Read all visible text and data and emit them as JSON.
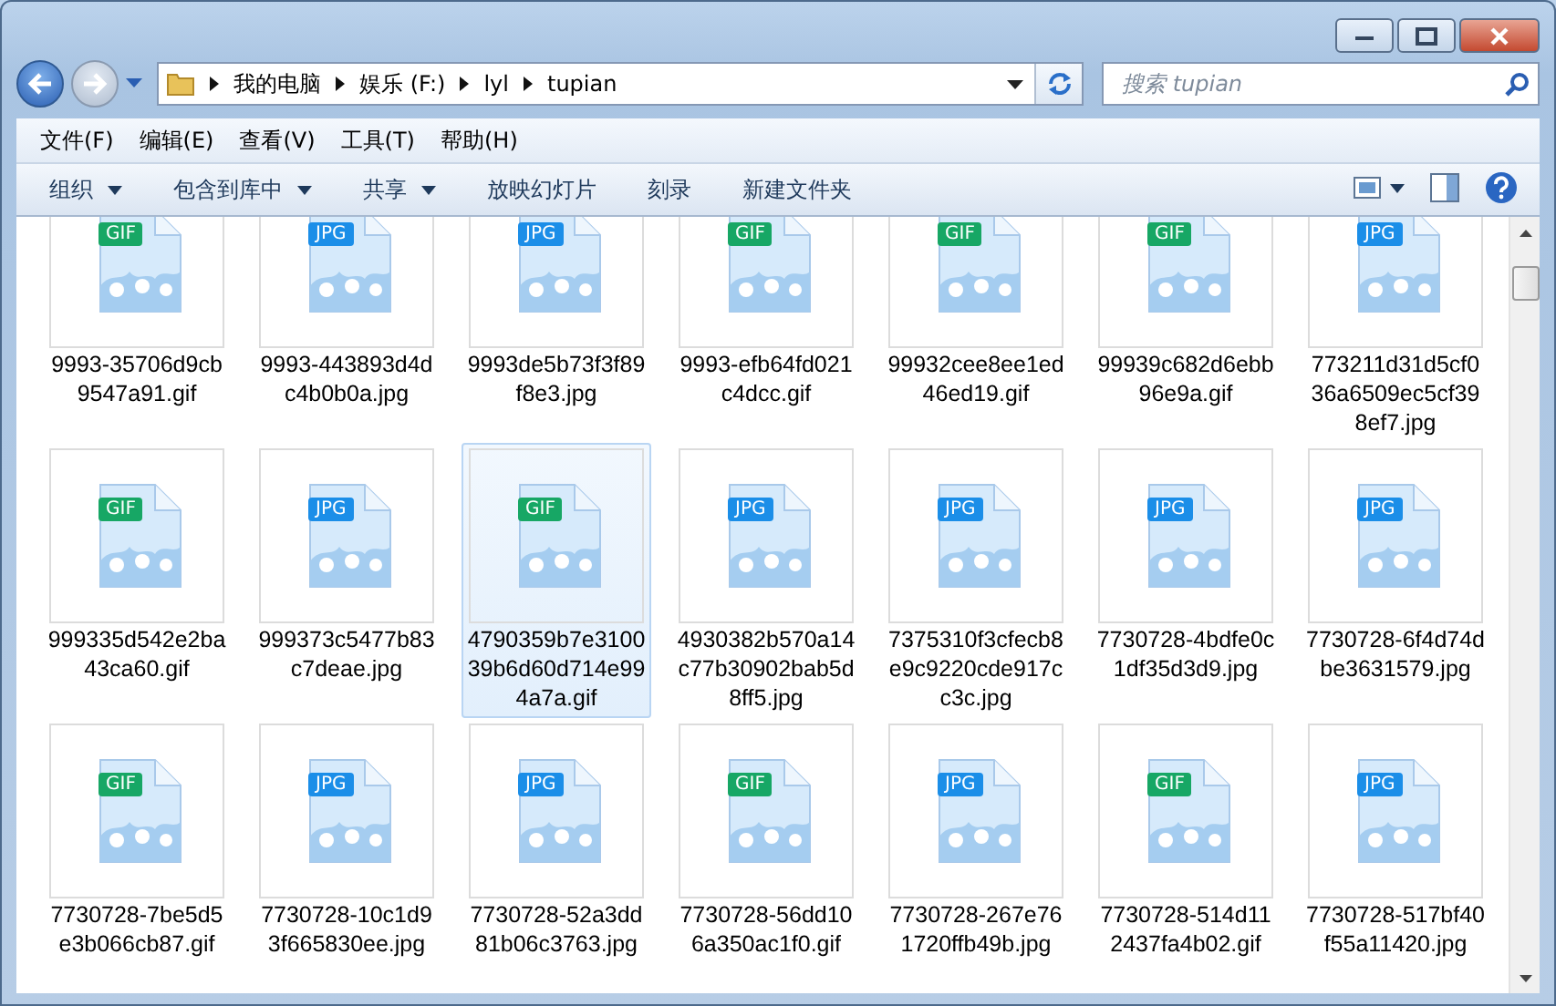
{
  "nav": {
    "breadcrumbs": [
      "我的电脑",
      "娱乐 (F:)",
      "lyl",
      "tupian"
    ],
    "search": {
      "placeholder": "搜索 tupian"
    }
  },
  "menu": [
    "文件(F)",
    "编辑(E)",
    "查看(V)",
    "工具(T)",
    "帮助(H)"
  ],
  "toolbar": [
    {
      "label": "组织",
      "has_menu": true
    },
    {
      "label": "包含到库中",
      "has_menu": true
    },
    {
      "label": "共享",
      "has_menu": true
    },
    {
      "label": "放映幻灯片",
      "has_menu": false
    },
    {
      "label": "刻录",
      "has_menu": false
    },
    {
      "label": "新建文件夹",
      "has_menu": false
    }
  ],
  "files": [
    {
      "name": "9993-35706d9cb9547a91.gif",
      "kind": "gif",
      "badge": "GIF",
      "selected": false
    },
    {
      "name": "9993-443893d4dc4b0b0a.jpg",
      "kind": "jpg",
      "badge": "JPG",
      "selected": false
    },
    {
      "name": "9993de5b73f3f89f8e3.jpg",
      "kind": "jpg",
      "badge": "JPG",
      "selected": false
    },
    {
      "name": "9993-efb64fd021c4dcc.gif",
      "kind": "gif",
      "badge": "GIF",
      "selected": false
    },
    {
      "name": "99932cee8ee1ed46ed19.gif",
      "kind": "gif",
      "badge": "GIF",
      "selected": false
    },
    {
      "name": "99939c682d6ebb96e9a.gif",
      "kind": "gif",
      "badge": "GIF",
      "selected": false
    },
    {
      "name": "773211d31d5cf036a6509ec5cf398ef7.jpg",
      "kind": "jpg",
      "badge": "JPG",
      "selected": false
    },
    {
      "name": "999335d542e2ba43ca60.gif",
      "kind": "gif",
      "badge": "GIF",
      "selected": false
    },
    {
      "name": "999373c5477b83c7deae.jpg",
      "kind": "jpg",
      "badge": "JPG",
      "selected": false
    },
    {
      "name": "4790359b7e310039b6d60d714e994a7a.gif",
      "kind": "gif",
      "badge": "GIF",
      "selected": true
    },
    {
      "name": "4930382b570a14c77b30902bab5d8ff5.jpg",
      "kind": "jpg",
      "badge": "JPG",
      "selected": false
    },
    {
      "name": "7375310f3cfecb8e9c9220cde917cc3c.jpg",
      "kind": "jpg",
      "badge": "JPG",
      "selected": false
    },
    {
      "name": "7730728-4bdfe0c1df35d3d9.jpg",
      "kind": "jpg",
      "badge": "JPG",
      "selected": false
    },
    {
      "name": "7730728-6f4d74dbe3631579.jpg",
      "kind": "jpg",
      "badge": "JPG",
      "selected": false
    },
    {
      "name": "7730728-7be5d5e3b066cb87.gif",
      "kind": "gif",
      "badge": "GIF",
      "selected": false
    },
    {
      "name": "7730728-10c1d93f665830ee.jpg",
      "kind": "jpg",
      "badge": "JPG",
      "selected": false
    },
    {
      "name": "7730728-52a3dd81b06c3763.jpg",
      "kind": "jpg",
      "badge": "JPG",
      "selected": false
    },
    {
      "name": "7730728-56dd106a350ac1f0.gif",
      "kind": "gif",
      "badge": "GIF",
      "selected": false
    },
    {
      "name": "7730728-267e761720ffb49b.jpg",
      "kind": "jpg",
      "badge": "JPG",
      "selected": false
    },
    {
      "name": "7730728-514d112437fa4b02.gif",
      "kind": "gif",
      "badge": "GIF",
      "selected": false
    },
    {
      "name": "7730728-517bf40f55a11420.jpg",
      "kind": "jpg",
      "badge": "JPG",
      "selected": false
    }
  ]
}
